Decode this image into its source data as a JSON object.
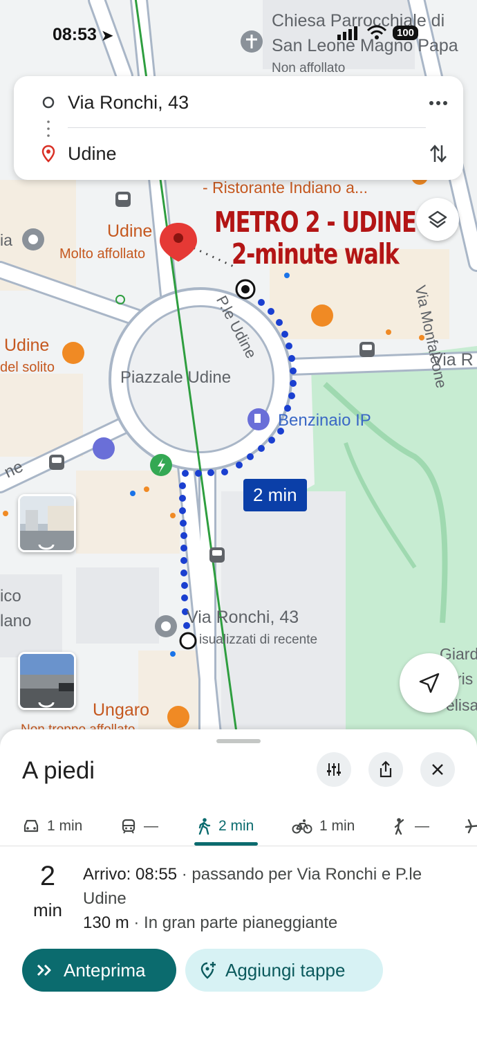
{
  "status_bar": {
    "time": "08:53",
    "battery": "100"
  },
  "route": {
    "origin": "Via Ronchi, 43",
    "destination": "Udine"
  },
  "map": {
    "overlay_title_line1": "METRO 2 - UDINE",
    "overlay_title_line2": "2-minute walk",
    "time_bubble": "2 min",
    "labels": {
      "church_line1": "Chiesa Parrocchiale di",
      "church_line2": "San Leone Magno Papa",
      "church_sub": "Non affollato",
      "restaurant": "- Ristorante Indiano a...",
      "monfalcone": "Via Monfalcone",
      "udine_pin": "Udine",
      "udine_pin_sub": "Molto affollato",
      "ia": "ia",
      "pie_udine": "P.le Udine",
      "udine_bar": "Udine",
      "udine_bar_sub": "del solito",
      "via_r": "Via R",
      "piazzale": "Piazzale Udine",
      "benzinaio": "Benzinaio IP",
      "ne": "ne",
      "ico": "ico",
      "lano": "lano",
      "via_ronchi": "Via Ronchi, 43",
      "recent": "isualizzati di recente",
      "giardi": "Giardi",
      "ris": "ris",
      "elisa": "elisa",
      "ungaro": "Ungaro",
      "not_crowded": "Non troppo affollato"
    }
  },
  "sheet": {
    "title": "A piedi",
    "modes": [
      {
        "icon": "car-icon",
        "label": "1 min"
      },
      {
        "icon": "train-icon",
        "label": "—"
      },
      {
        "icon": "walk-icon",
        "label": "2 min"
      },
      {
        "icon": "bike-icon",
        "label": "1 min"
      },
      {
        "icon": "ride-icon",
        "label": "—"
      }
    ],
    "active_mode": "walk",
    "eta_value": "2",
    "eta_unit": "min",
    "arrival_label": "Arrivo: 08:55",
    "via_text": " · passando per Via Ronchi e P.le Udine",
    "distance": "130 m",
    "terrain": " · In gran parte pianeggiante",
    "preview_button": "Anteprima",
    "add_stops_button": "Aggiungi tappe"
  },
  "colors": {
    "accent": "#0b6b6e",
    "route_blue": "#1a3fd0",
    "overlay_red": "#b31515",
    "park_green": "#c7ecd2"
  }
}
